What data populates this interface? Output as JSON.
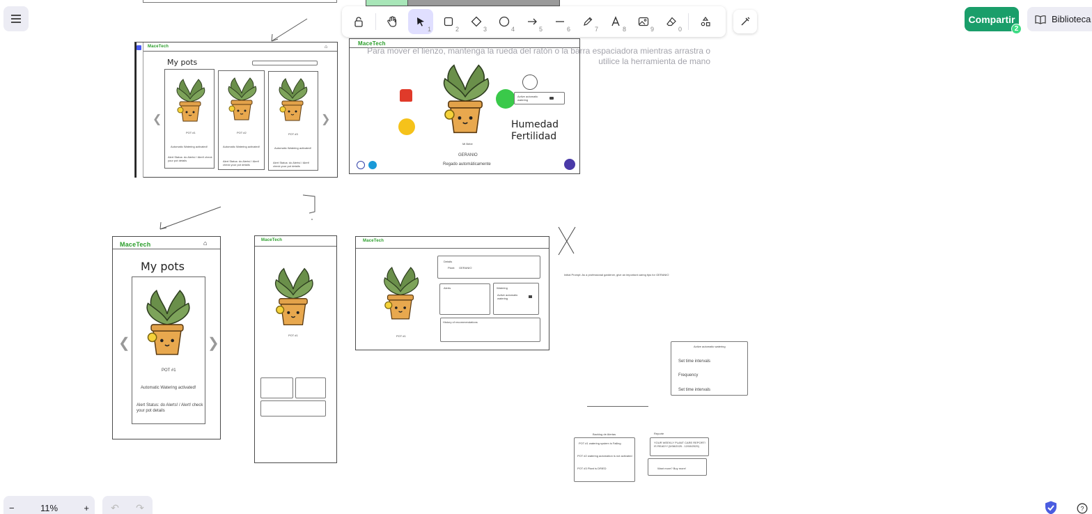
{
  "toolbar": {
    "tools": [
      {
        "name": "lock",
        "num": ""
      },
      {
        "name": "hand",
        "num": ""
      },
      {
        "name": "selection",
        "num": "1"
      },
      {
        "name": "rectangle",
        "num": "2"
      },
      {
        "name": "diamond",
        "num": "3"
      },
      {
        "name": "ellipse",
        "num": "4"
      },
      {
        "name": "arrow",
        "num": "5"
      },
      {
        "name": "line",
        "num": "6"
      },
      {
        "name": "draw",
        "num": "7"
      },
      {
        "name": "text",
        "num": "8"
      },
      {
        "name": "image",
        "num": "9"
      },
      {
        "name": "eraser",
        "num": "0"
      }
    ]
  },
  "header": {
    "share_label": "Compartir",
    "share_count": "2",
    "library_label": "Biblioteca"
  },
  "hint_text": "Para mover el lienzo, mantenga la rueda del ratón o la barra espaciadora mientras arrastra o utilice la herramienta de mano",
  "footer": {
    "zoom_minus": "−",
    "zoom_level": "11%",
    "zoom_plus": "+",
    "help": "?"
  },
  "canvas": {
    "brand": "MaceTech",
    "my_pots": "My pots",
    "pot_label": "POT #1",
    "pot_label_2": "POT #2",
    "pot_label_3": "POT #3",
    "auto_watering": "Automatic Watering activated!",
    "alert_text": "Alert Status: do Alerts! / Alert! check your pot details",
    "humedad": "Humedad",
    "fertilidad": "Fertilidad",
    "geranio": "GERANIO",
    "riego": "Regado automáticamente",
    "mi_bebe": "Mi Bebé",
    "details": "Details",
    "plant": "Plant:",
    "plant_value": "GERANIO",
    "alerts": "Alerts",
    "watering": "Watering",
    "active_auto_watering": "Active automatic watering",
    "history": "History of recommendations",
    "prompt_text": "Initial Prompt: As a professional gardener, give an important caring tips for GERANIO",
    "popup_title": "Active automatic watering",
    "set_time": "Set time intervals",
    "frequency": "Frequency",
    "set_time_2": "Set time intervals",
    "alert_box_title": "Backlog de Alertas",
    "alert_items": [
      "POT #1 watering system is Failing",
      "POT #2 watering automation is not activated",
      "POT #3 Plant is DRIED"
    ],
    "report_title": "Reporte",
    "report_text": "YOUR WEEKLY PLANT CARE REPORT! IS READY! (5/08/2025 - 12/08/2025)",
    "want_more": "Want more? Buy more!"
  }
}
